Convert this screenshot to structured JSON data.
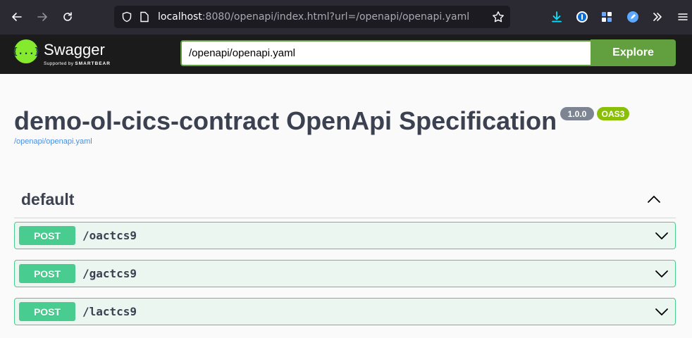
{
  "browser": {
    "url_host": "localhost",
    "url_rest": ":8080/openapi/index.html?url=/openapi/openapi.yaml",
    "back_icon": "arrow-left-icon",
    "forward_icon": "arrow-right-icon",
    "reload_icon": "reload-icon"
  },
  "topbar": {
    "logo_mark": "{...}",
    "logo_name": "Swagger",
    "logo_sub_prefix": "Supported by",
    "logo_sub_brand": "SMARTBEAR",
    "explore_value": "/openapi/openapi.yaml",
    "explore_label": "Explore"
  },
  "info": {
    "title": "demo-ol-cics-contract OpenApi Specification",
    "version": "1.0.0",
    "oas": "OAS3",
    "spec_url": "/openapi/openapi.yaml"
  },
  "tag": {
    "name": "default"
  },
  "operations": [
    {
      "method": "POST",
      "path": "/oactcs9"
    },
    {
      "method": "POST",
      "path": "/gactcs9"
    },
    {
      "method": "POST",
      "path": "/lactcs9"
    }
  ],
  "colors": {
    "post": "#49cc90",
    "post_bg": "#eaf6ef",
    "explore": "#62a03f",
    "swagger_green": "#85ea2d"
  }
}
